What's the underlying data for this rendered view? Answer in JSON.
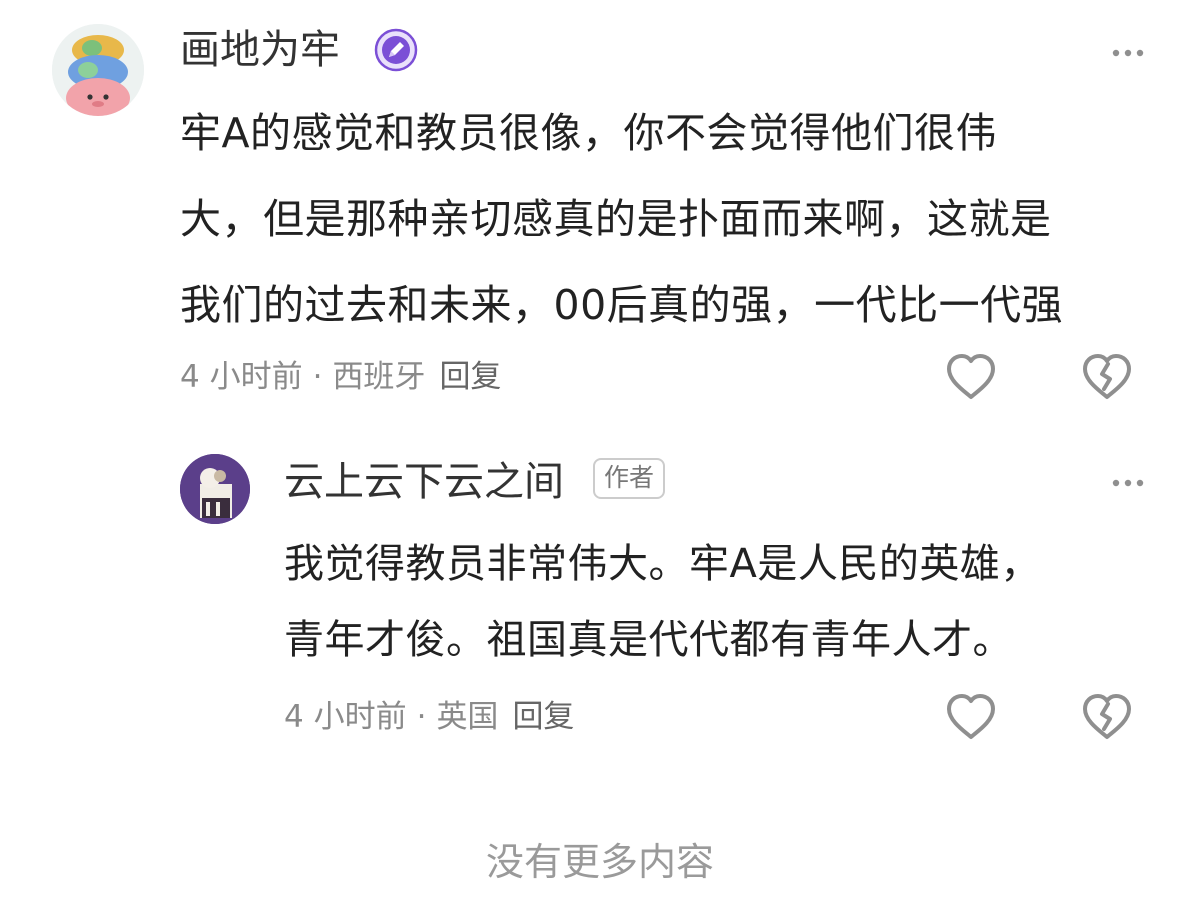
{
  "comments": [
    {
      "username": "画地为牢",
      "badge_icon": "creator-pen-badge-icon",
      "body_lines": [
        "牢A的感觉和教员很像，你不会觉得他们很伟",
        "大，但是那种亲切感真的是扑面而来啊，这就是",
        "我们的过去和未来，00后真的强，一代比一代强"
      ],
      "time": "4 小时前",
      "separator": "·",
      "location": "西班牙",
      "reply_label": "回复",
      "like_icon": "heart-icon",
      "dislike_icon": "broken-heart-icon",
      "more_icon": "more-dots-icon"
    }
  ],
  "replies": [
    {
      "username": "云上云下云之间",
      "author_tag": "作者",
      "body_lines": [
        "我觉得教员非常伟大。牢A是人民的英雄，",
        "青年才俊。祖国真是代代都有青年人才。"
      ],
      "time": "4 小时前",
      "separator": "·",
      "location": "英国",
      "reply_label": "回复",
      "like_icon": "heart-icon",
      "dislike_icon": "broken-heart-icon",
      "more_icon": "more-dots-icon"
    }
  ],
  "footer": {
    "text": "没有更多内容"
  },
  "colors": {
    "badge_purple": "#7b4fd6",
    "icon_gray": "#9a9a9a",
    "text_main": "#222222",
    "text_meta": "#8a8a8a"
  }
}
